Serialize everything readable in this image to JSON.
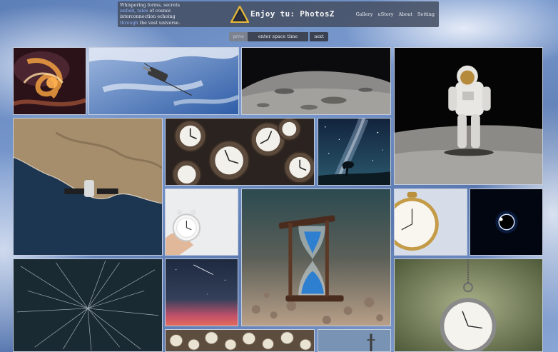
{
  "header": {
    "tagline_lines": [
      [
        "Whispering forms, secrets"
      ],
      [
        "unfold,",
        " tales",
        " of cosmic"
      ],
      [
        "interconnection echoing"
      ],
      [
        "through",
        " the vast universe."
      ]
    ],
    "tagline": {
      "l1": "Whispering forms, secrets",
      "l2a": "unfold,",
      "l2b": " tales",
      "l2c": " of cosmic",
      "l3": "interconnection echoing",
      "l4a": "through",
      "l4b": " the vast universe."
    },
    "brand": "Enjoy tu: PhotosZ",
    "nav": {
      "gallery": "Gallery",
      "ustory": "uStory",
      "about": "About",
      "setting": "Setting"
    }
  },
  "timebar": {
    "prev_label": "prive",
    "input_value": "enter space time",
    "next_label": "next"
  },
  "gallery": [
    "nebula-swirl",
    "satellite-over-clouds",
    "moon-surface",
    "astronaut-on-moon",
    "spacecraft-over-coast",
    "clocks-pile",
    "milky-way-tree",
    "hand-holding-clock",
    "hourglass",
    "pocket-watch-face",
    "solar-eclipse",
    "star-trails",
    "meteor-sunset",
    "pocket-watch-hanging",
    "watches-pile",
    "rocket-launch"
  ],
  "colors": {
    "header_bg": "#465064",
    "highlight": "#8fb4ff",
    "tile_border": "#cdd6e8"
  }
}
